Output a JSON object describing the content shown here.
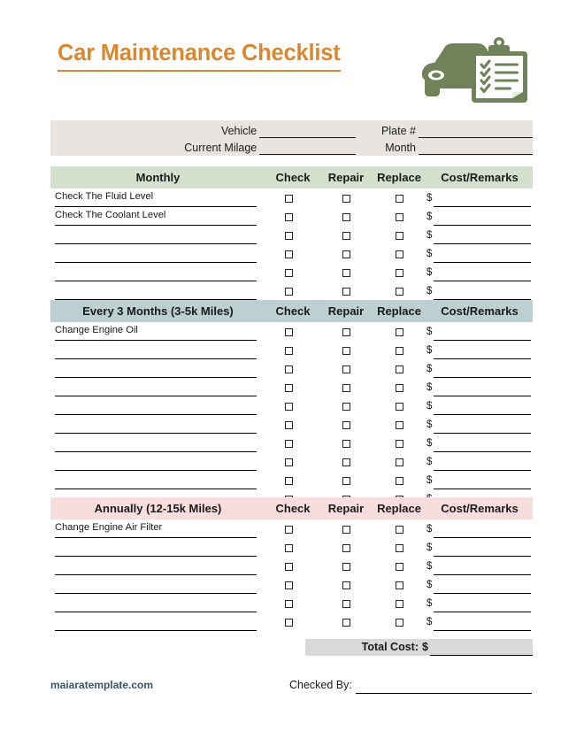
{
  "document": {
    "title": "Car Maintenance Checklist",
    "logo_icon": "car-clipboard-checklist-icon",
    "accent_color": "#d9882f",
    "logo_color": "#6f8258"
  },
  "info": {
    "fields": [
      {
        "label": "Vehicle",
        "value": ""
      },
      {
        "label": "Plate #",
        "value": ""
      },
      {
        "label": "Current Milage",
        "value": ""
      },
      {
        "label": "Month",
        "value": ""
      }
    ],
    "band_color": "#e8e5e1"
  },
  "columns": {
    "check": "Check",
    "repair": "Repair",
    "replace": "Replace",
    "cost": "Cost/Remarks",
    "currency": "$"
  },
  "sections": [
    {
      "title": "Monthly",
      "header_color": "#d4e0cd",
      "rows": [
        {
          "task": "Check The Fluid Level",
          "check": false,
          "repair": false,
          "replace": false,
          "cost": ""
        },
        {
          "task": "Check The Coolant Level",
          "check": false,
          "repair": false,
          "replace": false,
          "cost": ""
        },
        {
          "task": "",
          "check": false,
          "repair": false,
          "replace": false,
          "cost": ""
        },
        {
          "task": "",
          "check": false,
          "repair": false,
          "replace": false,
          "cost": ""
        },
        {
          "task": "",
          "check": false,
          "repair": false,
          "replace": false,
          "cost": ""
        },
        {
          "task": "",
          "check": false,
          "repair": false,
          "replace": false,
          "cost": ""
        }
      ]
    },
    {
      "title": "Every 3 Months (3-5k Miles)",
      "header_color": "#bcd0d2",
      "rows": [
        {
          "task": "Change Engine Oil",
          "check": false,
          "repair": false,
          "replace": false,
          "cost": ""
        },
        {
          "task": "",
          "check": false,
          "repair": false,
          "replace": false,
          "cost": ""
        },
        {
          "task": "",
          "check": false,
          "repair": false,
          "replace": false,
          "cost": ""
        },
        {
          "task": "",
          "check": false,
          "repair": false,
          "replace": false,
          "cost": ""
        },
        {
          "task": "",
          "check": false,
          "repair": false,
          "replace": false,
          "cost": ""
        },
        {
          "task": "",
          "check": false,
          "repair": false,
          "replace": false,
          "cost": ""
        },
        {
          "task": "",
          "check": false,
          "repair": false,
          "replace": false,
          "cost": ""
        },
        {
          "task": "",
          "check": false,
          "repair": false,
          "replace": false,
          "cost": ""
        },
        {
          "task": "",
          "check": false,
          "repair": false,
          "replace": false,
          "cost": ""
        },
        {
          "task": "",
          "check": false,
          "repair": false,
          "replace": false,
          "cost": ""
        }
      ]
    },
    {
      "title": "Annually (12-15k Miles)",
      "header_color": "#f7dedd",
      "rows": [
        {
          "task": "Change Engine Air Filter",
          "check": false,
          "repair": false,
          "replace": false,
          "cost": ""
        },
        {
          "task": "",
          "check": false,
          "repair": false,
          "replace": false,
          "cost": ""
        },
        {
          "task": "",
          "check": false,
          "repair": false,
          "replace": false,
          "cost": ""
        },
        {
          "task": "",
          "check": false,
          "repair": false,
          "replace": false,
          "cost": ""
        },
        {
          "task": "",
          "check": false,
          "repair": false,
          "replace": false,
          "cost": ""
        },
        {
          "task": "",
          "check": false,
          "repair": false,
          "replace": false,
          "cost": ""
        }
      ]
    }
  ],
  "total": {
    "label": "Total Cost:",
    "currency": "$",
    "value": "",
    "band_color": "#d9d9d9"
  },
  "footer": {
    "brand": "maiaratemplate.com",
    "checked_by_label": "Checked By:",
    "checked_by_value": ""
  }
}
